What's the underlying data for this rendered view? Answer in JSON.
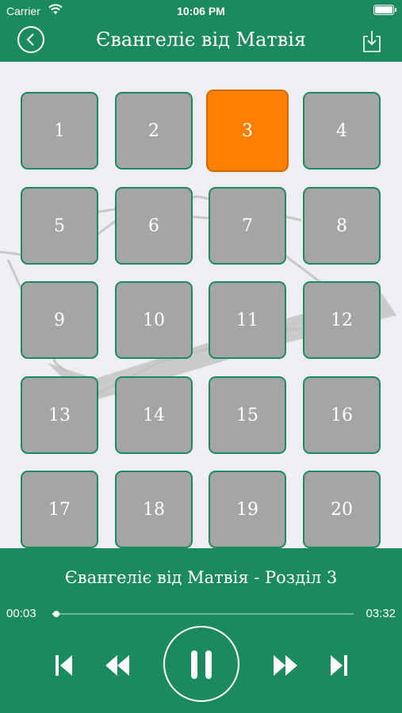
{
  "status": {
    "carrier": "Carrier",
    "time": "10:06 PM"
  },
  "header": {
    "title": "Євангеліє від Матвія",
    "back_icon": "back-arrow-icon",
    "download_icon": "download-icon"
  },
  "chapters": [
    "1",
    "2",
    "3",
    "4",
    "5",
    "6",
    "7",
    "8",
    "9",
    "10",
    "11",
    "12",
    "13",
    "14",
    "15",
    "16",
    "17",
    "18",
    "19",
    "20"
  ],
  "active_chapter": "3",
  "player": {
    "track_title": "Євангеліє від Матвія - Розділ 3",
    "current_time": "00:03",
    "total_time": "03:32",
    "progress": 0.014
  },
  "colors": {
    "accent": "#1b8a5e",
    "active": "#ff8000",
    "tile": "#a5a5a5"
  }
}
